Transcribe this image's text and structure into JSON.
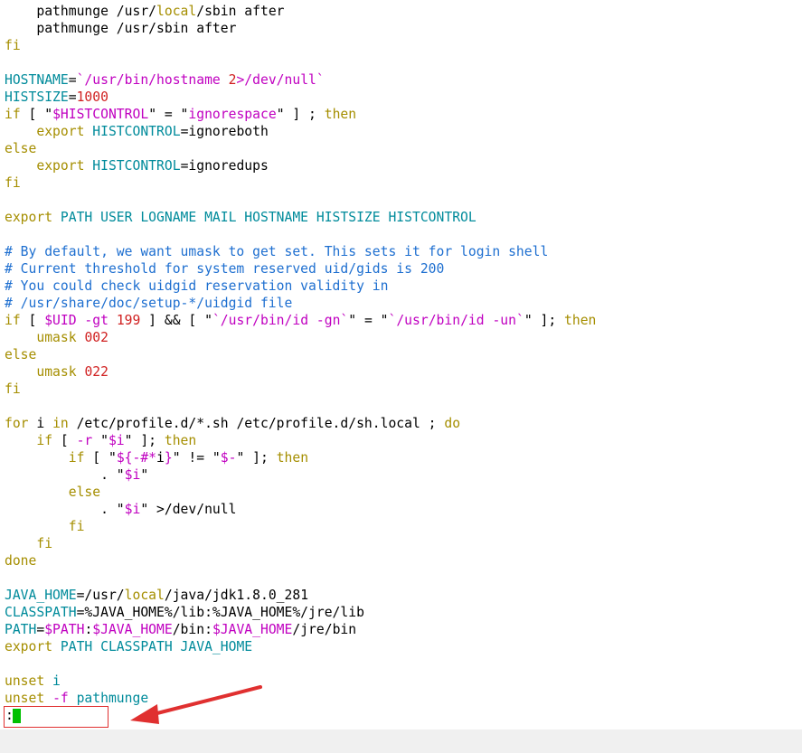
{
  "colors": {
    "default": "#000000",
    "keyword": "#a58e00",
    "variable": "#008b9b",
    "string": "#c000c0",
    "number": "#d02020",
    "comment": "#1e6fd0",
    "cursor": "#00c000",
    "annotation": "#e03030"
  },
  "lines": [
    [
      [
        "    ",
        "default"
      ],
      [
        "pathmunge /usr/",
        "default"
      ],
      [
        "local",
        "keyword"
      ],
      [
        "/sbin after",
        "default"
      ]
    ],
    [
      [
        "    pathmunge /usr/sbin after",
        "default"
      ]
    ],
    [
      [
        "fi",
        "keyword"
      ]
    ],
    [
      [
        "",
        "default"
      ]
    ],
    [
      [
        "HOSTNAME",
        "variable"
      ],
      [
        "=",
        "default"
      ],
      [
        "`/usr/bin/hostname ",
        "string"
      ],
      [
        "2",
        "number"
      ],
      [
        ">/dev/null`",
        "string"
      ]
    ],
    [
      [
        "HISTSIZE",
        "variable"
      ],
      [
        "=",
        "default"
      ],
      [
        "1000",
        "number"
      ]
    ],
    [
      [
        "if",
        "keyword"
      ],
      [
        " [ \"",
        "default"
      ],
      [
        "$HISTCONTROL",
        "string"
      ],
      [
        "\" = \"",
        "default"
      ],
      [
        "ignorespace",
        "string"
      ],
      [
        "\" ] ; ",
        "default"
      ],
      [
        "then",
        "keyword"
      ]
    ],
    [
      [
        "    ",
        "default"
      ],
      [
        "export",
        "keyword"
      ],
      [
        " ",
        "default"
      ],
      [
        "HISTCONTROL",
        "variable"
      ],
      [
        "=ignoreboth",
        "default"
      ]
    ],
    [
      [
        "else",
        "keyword"
      ]
    ],
    [
      [
        "    ",
        "default"
      ],
      [
        "export",
        "keyword"
      ],
      [
        " ",
        "default"
      ],
      [
        "HISTCONTROL",
        "variable"
      ],
      [
        "=ignoredups",
        "default"
      ]
    ],
    [
      [
        "fi",
        "keyword"
      ]
    ],
    [
      [
        "",
        "default"
      ]
    ],
    [
      [
        "export",
        "keyword"
      ],
      [
        " PATH USER LOGNAME MAIL HOSTNAME HISTSIZE HISTCONTROL",
        "variable"
      ]
    ],
    [
      [
        "",
        "default"
      ]
    ],
    [
      [
        "# By default, we want umask to get set. This sets it for login shell",
        "comment"
      ]
    ],
    [
      [
        "# Current threshold for system reserved uid/gids is 200",
        "comment"
      ]
    ],
    [
      [
        "# You could check uidgid reservation validity in",
        "comment"
      ]
    ],
    [
      [
        "# /usr/share/doc/setup-*/uidgid file",
        "comment"
      ]
    ],
    [
      [
        "if",
        "keyword"
      ],
      [
        " [ ",
        "default"
      ],
      [
        "$UID",
        "string"
      ],
      [
        " -gt ",
        "string"
      ],
      [
        "199",
        "number"
      ],
      [
        " ] && [ \"",
        "default"
      ],
      [
        "`/usr/bin/id -gn`",
        "string"
      ],
      [
        "\" = \"",
        "default"
      ],
      [
        "`/usr/bin/id -un`",
        "string"
      ],
      [
        "\" ]; ",
        "default"
      ],
      [
        "then",
        "keyword"
      ]
    ],
    [
      [
        "    ",
        "default"
      ],
      [
        "umask",
        "keyword"
      ],
      [
        " ",
        "default"
      ],
      [
        "002",
        "number"
      ]
    ],
    [
      [
        "else",
        "keyword"
      ]
    ],
    [
      [
        "    ",
        "default"
      ],
      [
        "umask",
        "keyword"
      ],
      [
        " ",
        "default"
      ],
      [
        "022",
        "number"
      ]
    ],
    [
      [
        "fi",
        "keyword"
      ]
    ],
    [
      [
        "",
        "default"
      ]
    ],
    [
      [
        "for",
        "keyword"
      ],
      [
        " i ",
        "default"
      ],
      [
        "in",
        "keyword"
      ],
      [
        " /etc/profile.d/*.sh /etc/profile.d/sh.local ; ",
        "default"
      ],
      [
        "do",
        "keyword"
      ]
    ],
    [
      [
        "    ",
        "default"
      ],
      [
        "if",
        "keyword"
      ],
      [
        " [ ",
        "default"
      ],
      [
        "-r",
        "string"
      ],
      [
        " \"",
        "default"
      ],
      [
        "$i",
        "string"
      ],
      [
        "\" ]; ",
        "default"
      ],
      [
        "then",
        "keyword"
      ]
    ],
    [
      [
        "        ",
        "default"
      ],
      [
        "if",
        "keyword"
      ],
      [
        " [ \"",
        "default"
      ],
      [
        "${-#*",
        "string"
      ],
      [
        "i",
        "default"
      ],
      [
        "}",
        "string"
      ],
      [
        "\" != \"",
        "default"
      ],
      [
        "$-",
        "string"
      ],
      [
        "\" ]; ",
        "default"
      ],
      [
        "then",
        "keyword"
      ]
    ],
    [
      [
        "            . \"",
        "default"
      ],
      [
        "$i",
        "string"
      ],
      [
        "\"",
        "default"
      ]
    ],
    [
      [
        "        ",
        "default"
      ],
      [
        "else",
        "keyword"
      ]
    ],
    [
      [
        "            . \"",
        "default"
      ],
      [
        "$i",
        "string"
      ],
      [
        "\" >/dev/null",
        "default"
      ]
    ],
    [
      [
        "        ",
        "default"
      ],
      [
        "fi",
        "keyword"
      ]
    ],
    [
      [
        "    ",
        "default"
      ],
      [
        "fi",
        "keyword"
      ]
    ],
    [
      [
        "done",
        "keyword"
      ]
    ],
    [
      [
        "",
        "default"
      ]
    ],
    [
      [
        "JAVA_HOME",
        "variable"
      ],
      [
        "=/usr/",
        "default"
      ],
      [
        "local",
        "keyword"
      ],
      [
        "/java/jdk1.8.0_281",
        "default"
      ]
    ],
    [
      [
        "CLASSPATH",
        "variable"
      ],
      [
        "=%JAVA_HOME%/lib:%JAVA_HOME%/jre/lib",
        "default"
      ]
    ],
    [
      [
        "PATH",
        "variable"
      ],
      [
        "=",
        "default"
      ],
      [
        "$PATH",
        "string"
      ],
      [
        ":",
        "default"
      ],
      [
        "$JAVA_HOME",
        "string"
      ],
      [
        "/bin:",
        "default"
      ],
      [
        "$JAVA_HOME",
        "string"
      ],
      [
        "/jre/bin",
        "default"
      ]
    ],
    [
      [
        "export",
        "keyword"
      ],
      [
        " PATH CLASSPATH JAVA_HOME",
        "variable"
      ]
    ],
    [
      [
        "",
        "default"
      ]
    ],
    [
      [
        "unset",
        "keyword"
      ],
      [
        " i",
        "variable"
      ]
    ],
    [
      [
        "unset",
        "keyword"
      ],
      [
        " ",
        "default"
      ],
      [
        "-f",
        "string"
      ],
      [
        " pathmunge",
        "variable"
      ]
    ]
  ],
  "command_line": {
    "prompt": ":"
  }
}
